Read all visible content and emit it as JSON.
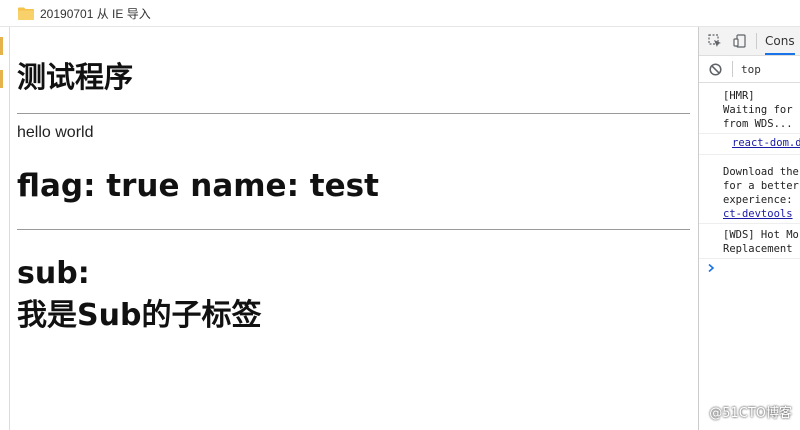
{
  "bookmark_bar": {
    "folder_label": "20190701 从 IE 导入"
  },
  "page": {
    "title": "测试程序",
    "hello": "hello world",
    "flag_line": "flag: true name: test",
    "sub_label": "sub:",
    "sub_child": "我是Sub的子标签"
  },
  "devtools": {
    "tab_label": "Cons",
    "context": "top",
    "log_1": "[HMR]\nWaiting for\nfrom WDS...",
    "log_1_link": "react-dom.d",
    "log_2": "Download the\nfor a better\nexperience:",
    "log_2_link": "ct-devtools",
    "log_3": "[WDS] Hot Mo\nReplacement"
  },
  "watermark": "@51CTO博客",
  "colors": {
    "folder": "#f5c24c",
    "link": "#1a1aa6",
    "prompt": "#1a73e8"
  },
  "icons": [
    "folder-icon",
    "inspect-element-icon",
    "device-toggle-icon",
    "clear-console-icon",
    "prompt-chevron-icon"
  ]
}
